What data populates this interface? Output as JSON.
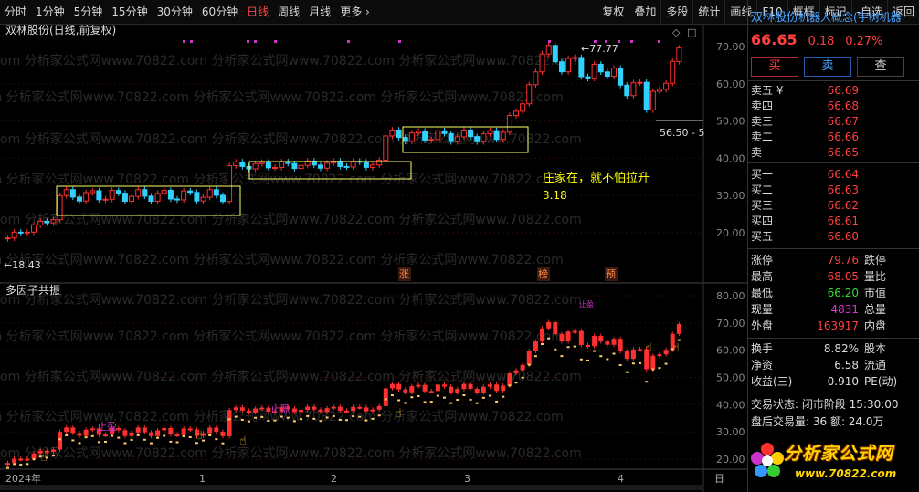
{
  "toolbar": {
    "left": [
      "分时",
      "1分钟",
      "5分钟",
      "15分钟",
      "30分钟",
      "60分钟",
      "日线",
      "周线",
      "月线",
      "更多 ›"
    ],
    "active_index": 6,
    "right": [
      "复权",
      "叠加",
      "多股",
      "统计",
      "画线",
      "F10",
      "框框",
      "标记",
      "-自选",
      "返回"
    ]
  },
  "main_chart": {
    "title": "双林股份(日线,前复权)",
    "y_ticks": [
      "70.00",
      "60.00",
      "50.00",
      "40.00",
      "30.00",
      "20.00"
    ],
    "high_label": "77.77",
    "low_label": "18.43",
    "price_marker": "56.50 - 5",
    "annotation_text": "庄家在，就不怕拉升",
    "annotation_value": "3.18",
    "markers": [
      "涨",
      "榜",
      "预"
    ]
  },
  "sub_chart": {
    "title": "多因子共振",
    "y_ticks": [
      "80.00",
      "70.00",
      "60.00",
      "50.00",
      "40.00",
      "30.00",
      "20.00"
    ],
    "labels": [
      "止盈",
      "止盈"
    ],
    "purple_label": "止盈"
  },
  "x_axis": {
    "labels": [
      "2024年",
      "1",
      "2",
      "3",
      "4"
    ],
    "right_label": "日"
  },
  "watermark": "om 分析家公式网www.70822.com 分析家公式网www.70822.com 分析家公式网www.70822.com",
  "quote": {
    "name": "双林股份",
    "concept": "机器人概念(宇树机器",
    "price": "66.65",
    "change": "0.18",
    "change_pct": "0.27%",
    "buttons": [
      "买",
      "卖",
      "查"
    ],
    "sell_levels": [
      {
        "label": "卖五 ¥",
        "price": "66.69"
      },
      {
        "label": "卖四",
        "price": "66.68"
      },
      {
        "label": "卖三",
        "price": "66.67"
      },
      {
        "label": "卖二",
        "price": "66.66"
      },
      {
        "label": "卖一",
        "price": "66.65"
      }
    ],
    "buy_levels": [
      {
        "label": "买一",
        "price": "66.64"
      },
      {
        "label": "买二",
        "price": "66.63"
      },
      {
        "label": "买三",
        "price": "66.62"
      },
      {
        "label": "买四",
        "price": "66.61"
      },
      {
        "label": "买五",
        "price": "66.60"
      }
    ],
    "stats": [
      {
        "k": "涨停",
        "v": "79.76",
        "color": "#ff4040",
        "k2": "跌停"
      },
      {
        "k": "最高",
        "v": "68.05",
        "color": "#ff4040",
        "k2": "量比"
      },
      {
        "k": "最低",
        "v": "66.20",
        "color": "#33dd33",
        "k2": "市值"
      },
      {
        "k": "现量",
        "v": "4831",
        "color": "#dd33dd",
        "k2": "总量"
      },
      {
        "k": "外盘",
        "v": "163917",
        "color": "#ff4040",
        "k2": "内盘"
      }
    ],
    "stats2": [
      {
        "k": "换手",
        "v": "8.82%",
        "color": "#dddddd",
        "k2": "股本"
      },
      {
        "k": "净资",
        "v": "6.58",
        "color": "#dddddd",
        "k2": "流通"
      },
      {
        "k": "收益(三)",
        "v": "0.910",
        "color": "#dddddd",
        "k2": "PE(动)"
      }
    ],
    "status_line1": "交易状态: 闭市阶段 15:30:00",
    "status_line2": "盘后交易量: 36  额: 24.0万",
    "logo_text": "分析家公式网",
    "logo_url": "www.70822.com"
  },
  "colors": {
    "up": "#ff3030",
    "down": "#30d0ff",
    "box": "#ffff66",
    "text_yellow": "#ffff00"
  }
}
